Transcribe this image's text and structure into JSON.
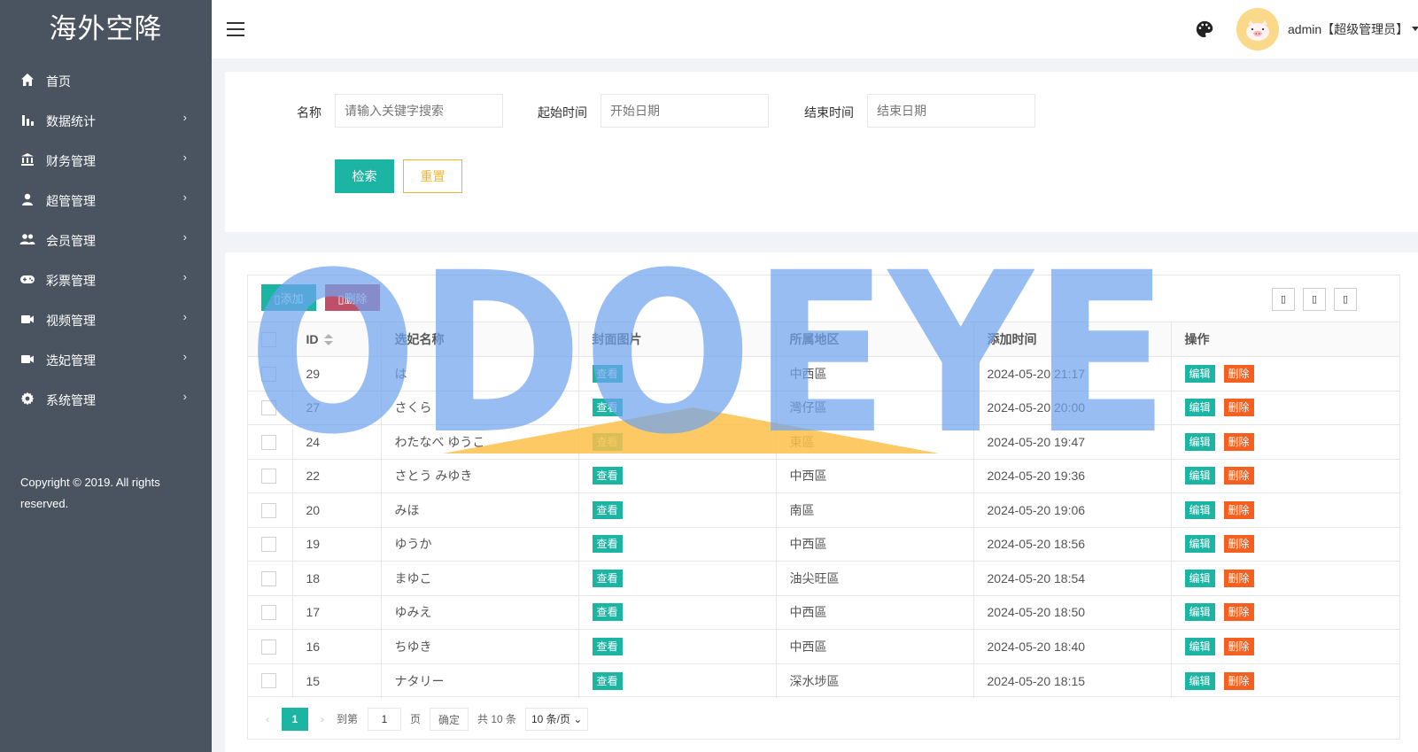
{
  "app": {
    "brand": "海外空降",
    "copyright": "Copyright © 2019. All rights reserved."
  },
  "sidebar": {
    "items": [
      {
        "label": "首页",
        "icon": "home-icon",
        "chevron": ""
      },
      {
        "label": "数据统计",
        "icon": "bar-chart-icon",
        "chevron": "›"
      },
      {
        "label": "财务管理",
        "icon": "bank-icon",
        "chevron": "›"
      },
      {
        "label": "超管管理",
        "icon": "user-icon",
        "chevron": "›"
      },
      {
        "label": "会员管理",
        "icon": "users-icon",
        "chevron": "›"
      },
      {
        "label": "彩票管理",
        "icon": "gamepad-icon",
        "chevron": "›"
      },
      {
        "label": "视频管理",
        "icon": "video-icon",
        "chevron": "›"
      },
      {
        "label": "选妃管理",
        "icon": "video-icon",
        "chevron": "›"
      },
      {
        "label": "系统管理",
        "icon": "gear-icon",
        "chevron": "›"
      }
    ]
  },
  "header": {
    "user": "admin【超级管理员】",
    "menu_icon": "hamburger-icon",
    "theme_icon": "palette-icon"
  },
  "search": {
    "name_label": "名称",
    "name_placeholder": "请输入关键字搜索",
    "start_label": "起始时间",
    "start_placeholder": "开始日期",
    "end_label": "结束时间",
    "end_placeholder": "结束日期",
    "search_btn": "检索",
    "reset_btn": "重置"
  },
  "toolbar": {
    "add_label": "添加",
    "delete_label": "删除",
    "right_icons": [
      "filter-columns-icon",
      "export-icon",
      "print-icon"
    ]
  },
  "table": {
    "columns": [
      "ID",
      "选妃名称",
      "封面图片",
      "所属地区",
      "添加时间",
      "操作"
    ],
    "view_label": "查看",
    "edit_label": "编辑",
    "remove_label": "删除",
    "rows": [
      {
        "id": "29",
        "name": "は",
        "region": "中西區",
        "time": "2024-05-20 21:17"
      },
      {
        "id": "27",
        "name": "さくら",
        "region": "灣仔區",
        "time": "2024-05-20 20:00"
      },
      {
        "id": "24",
        "name": "わたなべ ゆうこ",
        "region": "東區",
        "time": "2024-05-20 19:47"
      },
      {
        "id": "22",
        "name": "さとう みゆき",
        "region": "中西區",
        "time": "2024-05-20 19:36"
      },
      {
        "id": "20",
        "name": "みほ",
        "region": "南區",
        "time": "2024-05-20 19:06"
      },
      {
        "id": "19",
        "name": "ゆうか",
        "region": "中西區",
        "time": "2024-05-20 18:56"
      },
      {
        "id": "18",
        "name": "まゆこ",
        "region": "油尖旺區",
        "time": "2024-05-20 18:54"
      },
      {
        "id": "17",
        "name": "ゆみえ",
        "region": "中西區",
        "time": "2024-05-20 18:50"
      },
      {
        "id": "16",
        "name": "ちゆき",
        "region": "中西區",
        "time": "2024-05-20 18:40"
      },
      {
        "id": "15",
        "name": "ナタリー",
        "region": "深水埗區",
        "time": "2024-05-20 18:15"
      }
    ]
  },
  "pager": {
    "prev": "‹",
    "current": "1",
    "next": "›",
    "goto_label": "到第",
    "goto_value": "1",
    "page_unit": "页",
    "confirm": "确定",
    "total": "共 10 条",
    "per_page": "10 条/页"
  },
  "watermark": {
    "text": "ODOEYE"
  },
  "colors": {
    "sidebar": "#4a5460",
    "accent": "#1cb5a4",
    "danger": "#f56021",
    "warning": "#f3b42a",
    "watermark_blue": "#6fa3ef",
    "watermark_orange": "#fbbf4a"
  }
}
